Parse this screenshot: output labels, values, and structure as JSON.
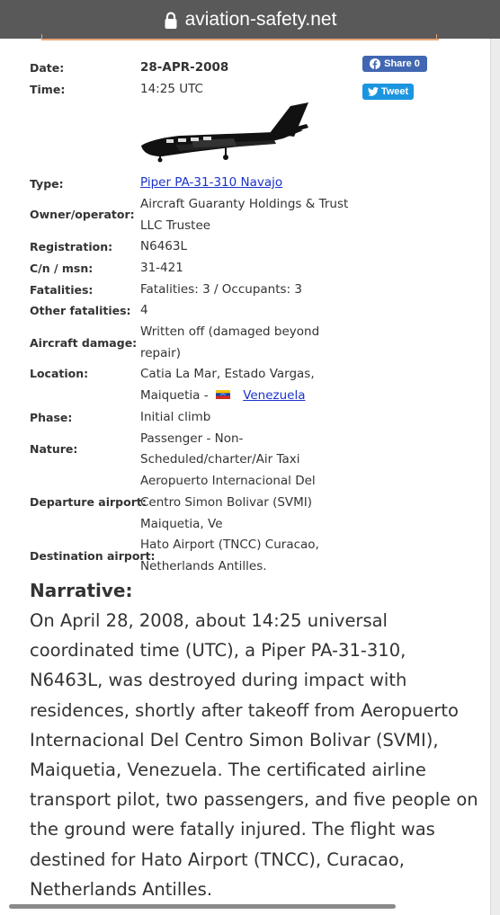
{
  "urlbar": {
    "domain": "aviation-safety.net"
  },
  "share": {
    "facebook_label": "Share 0",
    "tweet_label": "Tweet"
  },
  "record": {
    "date_label": "Date:",
    "date": "28-APR-2008",
    "time_label": "Time:",
    "time": "14:25 UTC",
    "type_label": "Type:",
    "type": "Piper PA-31-310 Navajo",
    "owner_label": "Owner/operator:",
    "owner_line1": "Aircraft Guaranty Holdings & Trust",
    "owner_line2": "LLC Trustee",
    "registration_label": "Registration:",
    "registration": "N6463L",
    "cn_label": "C/n / msn:",
    "cn": "31-421",
    "fatalities_label": "Fatalities:",
    "fatalities": "Fatalities: 3 / Occupants: 3",
    "other_fatalities_label": "Other fatalities:",
    "other_fatalities": "4",
    "damage_label": "Aircraft damage:",
    "damage_line1": "Written off (damaged beyond",
    "damage_line2": "repair)",
    "location_label": "Location:",
    "location_line1": "Catia La Mar, Estado Vargas,",
    "location_line2": "Maiquetia -",
    "location_country": "Venezuela",
    "phase_label": "Phase:",
    "phase": "Initial climb",
    "nature_label": "Nature:",
    "nature_line1": "Passenger - Non-",
    "nature_line2": "Scheduled/charter/Air Taxi",
    "departure_label": "Departure airport:",
    "departure_line1": "Aeropuerto Internacional Del",
    "departure_line2": "Centro Simon Bolivar (SVMI)",
    "departure_line3": "Maiquetia, Ve",
    "destination_label": "Destination airport:",
    "destination_line1": "Hato Airport (TNCC) Curacao,",
    "destination_line2": "Netherlands Antilles."
  },
  "narrative": {
    "title": "Narrative:",
    "text": "On April 28, 2008, about 14:25 universal coordinated time (UTC), a Piper PA-31-310, N6463L, was destroyed during impact with residences, shortly after takeoff from Aeropuerto Internacional Del Centro Simon Bolivar (SVMI), Maiquetia, Venezuela. The certificated airline transport pilot, two passengers, and five people on the ground were fatally injured. The flight was destined for Hato Airport (TNCC), Curacao, Netherlands Antilles."
  },
  "icons": [
    "lock-icon",
    "facebook-icon",
    "twitter-icon",
    "aircraft-silhouette",
    "venezuela-flag-icon"
  ]
}
